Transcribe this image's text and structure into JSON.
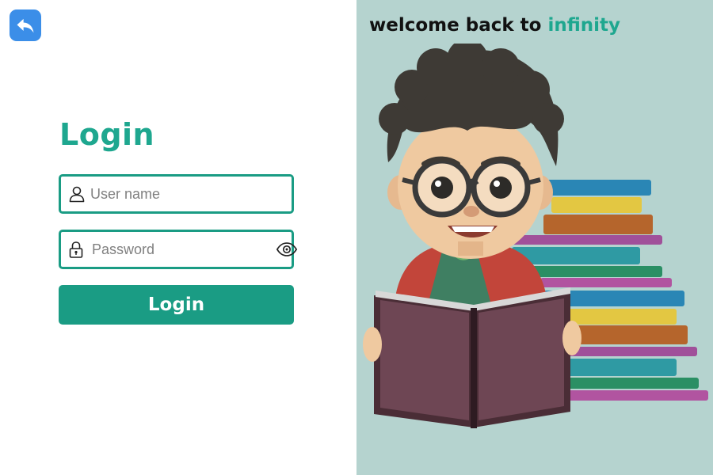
{
  "header": {
    "back_icon": "reply-arrow-icon"
  },
  "form": {
    "title": "Login",
    "username": {
      "placeholder": "User name",
      "value": "",
      "icon": "user-icon"
    },
    "password": {
      "placeholder": "Password",
      "value": "",
      "icon": "lock-icon",
      "toggle_icon": "eye-icon"
    },
    "submit_label": "Login"
  },
  "panel": {
    "welcome_prefix": "welcome back to",
    "welcome_brand": "infinity"
  },
  "colors": {
    "accent": "#1a9c84",
    "accent_text": "#1ea78f",
    "back_button": "#3b8ee8",
    "panel_background": "#b5d3cf"
  }
}
